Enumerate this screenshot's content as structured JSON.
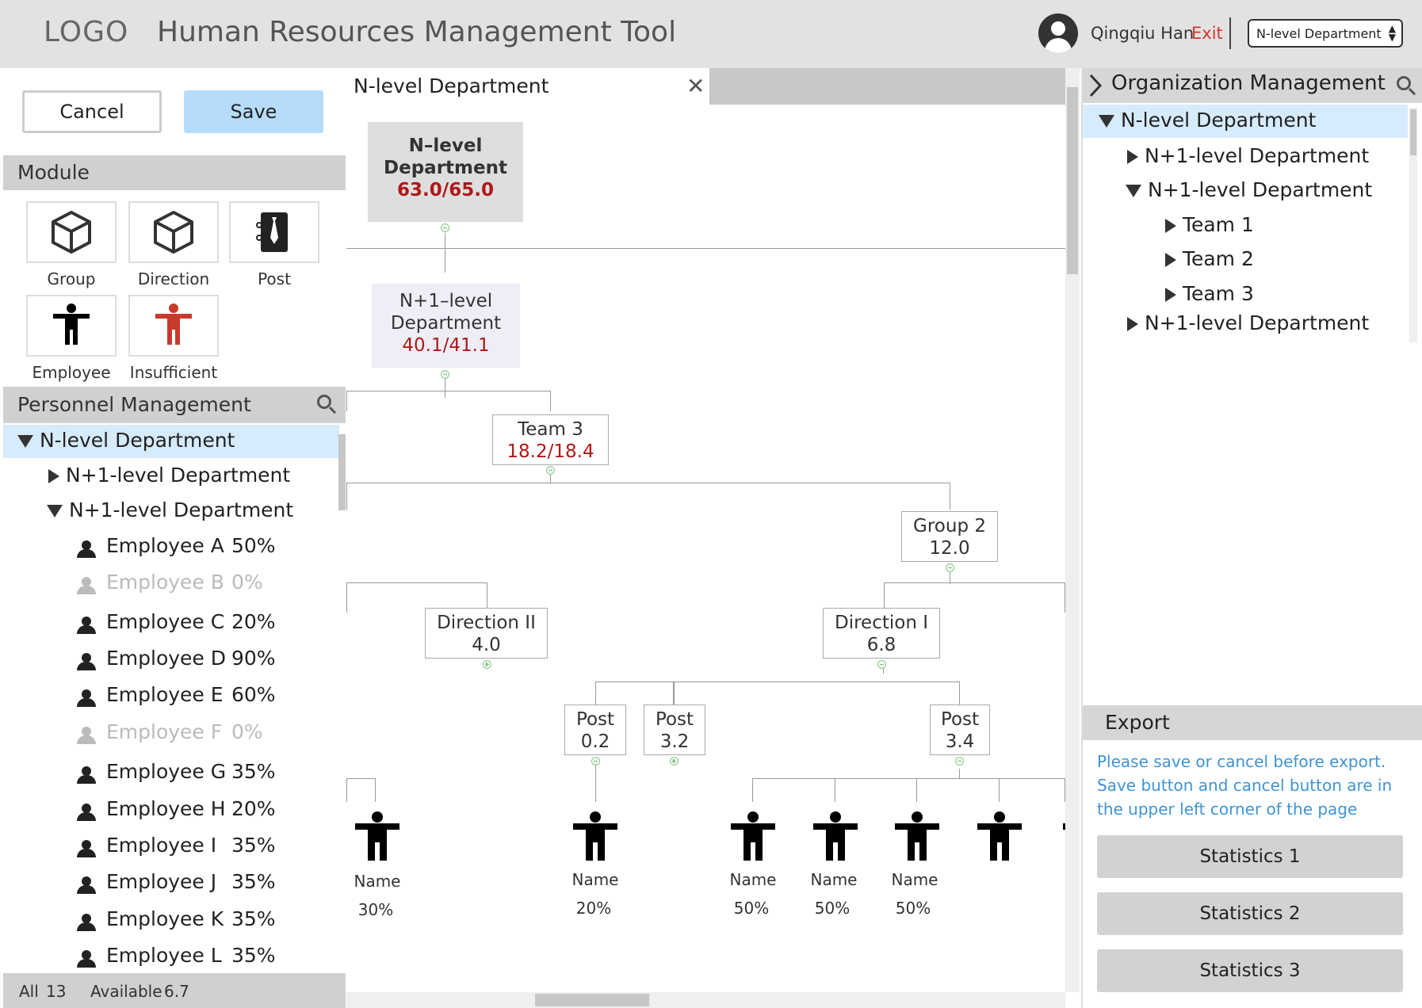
{
  "header": {
    "logo": "LOGO",
    "app_title": "Human Resources Management Tool",
    "user_name": "Qingqiu Han",
    "exit_label": "Exit",
    "dept_select_value": "N-level Department"
  },
  "left": {
    "cancel_label": "Cancel",
    "save_label": "Save",
    "module_title": "Module",
    "modules": [
      "Group",
      "Direction",
      "Post",
      "Employee",
      "Insufficient"
    ],
    "personnel_title": "Personnel Management",
    "tree": {
      "root": "N-level Department",
      "children": [
        "N+1-level Department",
        "N+1-level Department"
      ]
    },
    "employees": [
      {
        "name": "Employee A",
        "pct": "50%"
      },
      {
        "name": "Employee B",
        "pct": "0%"
      },
      {
        "name": "Employee C",
        "pct": "20%"
      },
      {
        "name": "Employee D",
        "pct": "90%"
      },
      {
        "name": "Employee E",
        "pct": "60%"
      },
      {
        "name": "Employee F",
        "pct": "0%"
      },
      {
        "name": "Employee G",
        "pct": "35%"
      },
      {
        "name": "Employee H",
        "pct": "20%"
      },
      {
        "name": "Employee I",
        "pct": "35%"
      },
      {
        "name": "Employee J",
        "pct": "35%"
      },
      {
        "name": "Employee K",
        "pct": "35%"
      },
      {
        "name": "Employee L",
        "pct": "35%"
      }
    ],
    "footer": {
      "all_label": "All",
      "all_value": "13",
      "avail_label": "Available",
      "avail_value": "6.7"
    }
  },
  "center": {
    "tab_title": "N-level Department",
    "nodes": {
      "root": {
        "line1": "N–level",
        "line2": "Department",
        "value": "63.0/65.0"
      },
      "n1": {
        "line1": "N+1–level",
        "line2": "Department",
        "value": "40.1/41.1"
      },
      "team3": {
        "label": "Team 3",
        "value": "18.2/18.4"
      },
      "group2": {
        "label": "Group 2",
        "value": "12.0"
      },
      "dir2": {
        "label": "Direction II",
        "value": "4.0"
      },
      "dir1": {
        "label": "Direction I",
        "value": "6.8"
      },
      "post_a": {
        "label": "Post",
        "value": "0.2"
      },
      "post_b": {
        "label": "Post",
        "value": "3.2"
      },
      "post_c": {
        "label": "Post",
        "value": "3.4"
      }
    },
    "people": [
      {
        "name": "Name",
        "pct": "30%"
      },
      {
        "name": "Name",
        "pct": "20%"
      },
      {
        "name": "Name",
        "pct": "50%"
      },
      {
        "name": "Name",
        "pct": "50%"
      },
      {
        "name": "Name",
        "pct": "50%"
      }
    ]
  },
  "right": {
    "title": "Organization Management",
    "tree": {
      "root": "N-level Department",
      "item1": "N+1-level Department",
      "item2": "N+1-level Department",
      "teams": [
        "Team 1",
        "Team 2",
        "Team 3"
      ],
      "item3": "N+1-level Department"
    },
    "export_title": "Export",
    "export_msg": "Please save or cancel before export. Save button and cancel button are in the upper left corner of the page",
    "stats": [
      "Statistics 1",
      "Statistics 2",
      "Statistics 3"
    ]
  },
  "colors": {
    "save_bg": "#b5dcfb",
    "selected_row": "#d6ebfc",
    "value_red": "#b01818",
    "exit_red": "#d23a2a",
    "export_msg_blue": "#3f94d6",
    "insufficient_red": "#c93a2c"
  },
  "icons": [
    "cube-icon",
    "post-tie-icon",
    "employee-figure-icon",
    "user-avatar-icon",
    "search-icon",
    "close-icon",
    "chevron-right-icon"
  ]
}
